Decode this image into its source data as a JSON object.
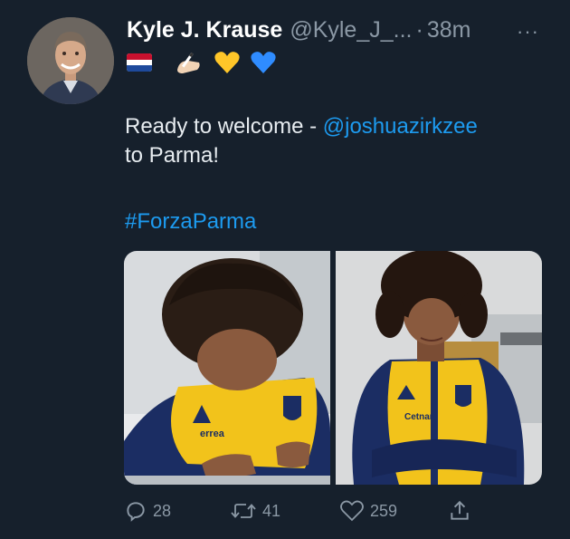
{
  "tweet": {
    "author_name": "Kyle J. Krause",
    "handle": "@Kyle_J_...",
    "separator": "·",
    "time": "38m",
    "more": "···",
    "text_intro": "Ready to welcome - ",
    "mention": "@joshuazirkzee",
    "text_end": "to Parma!",
    "hashtag": "#ForzaParma",
    "emojis": [
      "netherlands-flag",
      "writing-hand",
      "yellow-heart",
      "blue-heart"
    ]
  },
  "actions": {
    "reply_count": "28",
    "retweet_count": "41",
    "like_count": "259"
  },
  "colors": {
    "background": "#16202c",
    "link": "#1d9bf0",
    "muted": "#8b98a5",
    "parma_yellow": "#f2c31b",
    "parma_blue": "#1b2d63"
  }
}
